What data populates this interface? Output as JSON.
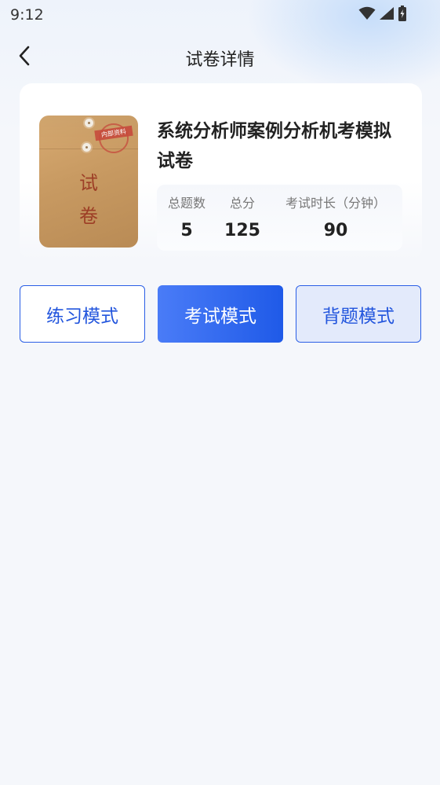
{
  "status_bar": {
    "time": "9:12",
    "icons": [
      "wifi-icon",
      "signal-icon",
      "battery-icon"
    ]
  },
  "header": {
    "back_icon": "chevron-left-icon",
    "title": "试卷详情"
  },
  "exam": {
    "cover": {
      "stamp_text": "内部资料",
      "chars": [
        "试",
        "卷"
      ]
    },
    "title": "系统分析师案例分析机考模拟试卷",
    "stats": [
      {
        "label": "总题数",
        "value": "5"
      },
      {
        "label": "总分",
        "value": "125"
      },
      {
        "label": "考试时长（分钟）",
        "value": "90"
      }
    ]
  },
  "modes": {
    "practice_label": "练习模式",
    "exam_label": "考试模式",
    "recite_label": "背题模式"
  },
  "colors": {
    "accent": "#2255dd",
    "exam_button_start": "#4a7cf7",
    "exam_button_end": "#1f5ae8",
    "recite_button_bg": "#e3eafb",
    "page_bg": "#f5f7fb"
  }
}
